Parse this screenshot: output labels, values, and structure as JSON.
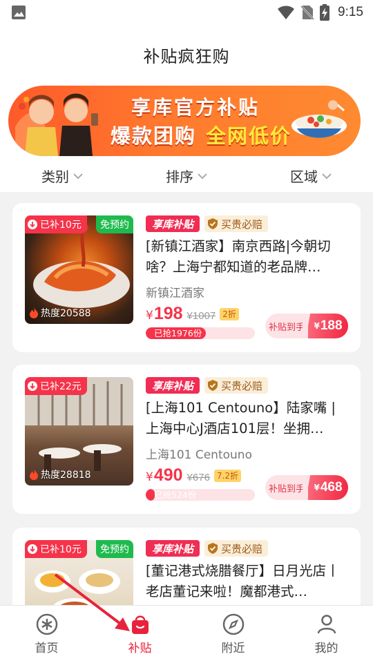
{
  "status": {
    "time": "9:15"
  },
  "header": {
    "title": "补贴疯狂购"
  },
  "banner": {
    "line1": "享库官方补贴",
    "line2": "爆款团购",
    "line2_highlight": "全网低价"
  },
  "filters": [
    {
      "label": "类别"
    },
    {
      "label": "排序"
    },
    {
      "label": "区域"
    }
  ],
  "cards": [
    {
      "subsidy_tag": "已补10元",
      "booking_tag": "免预约",
      "heat": "热度20588",
      "brand_badge": "享库补贴",
      "guarantee_badge": "买贵必赔",
      "title": "[新镇江酒家】南京西路|今朝切啥？上海宁都知道的老品牌…",
      "shop": "新镇江酒家",
      "yen": "¥",
      "price": "198",
      "original_price": "¥1007",
      "discount": "2折",
      "sold": "已抢1976份",
      "sold_fraction": 0.55,
      "pay_label": "补贴到手",
      "pay_yen": "¥",
      "pay_price": "188"
    },
    {
      "subsidy_tag": "已补22元",
      "booking_tag": "",
      "heat": "热度28818",
      "brand_badge": "享库补贴",
      "guarantee_badge": "买贵必赔",
      "title": "[上海101 Centouno】陆家嘴 | 上海中心J酒店101层！坐拥…",
      "shop": "上海101 Centouno",
      "yen": "¥",
      "price": "490",
      "original_price": "¥676",
      "discount": "7.2折",
      "sold": "已抢524份",
      "sold_fraction": 0.08,
      "pay_label": "补贴到手",
      "pay_yen": "¥",
      "pay_price": "468"
    },
    {
      "subsidy_tag": "已补10元",
      "booking_tag": "免预约",
      "heat": "",
      "brand_badge": "享库补贴",
      "guarantee_badge": "买贵必赔",
      "title": "[董记港式烧腊餐厅】日月光店丨老店董记来啦！魔都港式…",
      "shop": "",
      "yen": "",
      "price": "",
      "original_price": "",
      "discount": "",
      "sold": "",
      "sold_fraction": 0,
      "pay_label": "",
      "pay_yen": "",
      "pay_price": ""
    }
  ],
  "bottom_nav": [
    {
      "label": "首页",
      "icon": "home-icon"
    },
    {
      "label": "补贴",
      "icon": "subsidy-bag-icon",
      "active": true
    },
    {
      "label": "附近",
      "icon": "compass-icon"
    },
    {
      "label": "我的",
      "icon": "profile-icon"
    }
  ],
  "colors": {
    "accent": "#f5334a",
    "banner": "#ff6a2e",
    "booking": "#1fba4e",
    "guarantee_bg": "#fbeed9"
  }
}
